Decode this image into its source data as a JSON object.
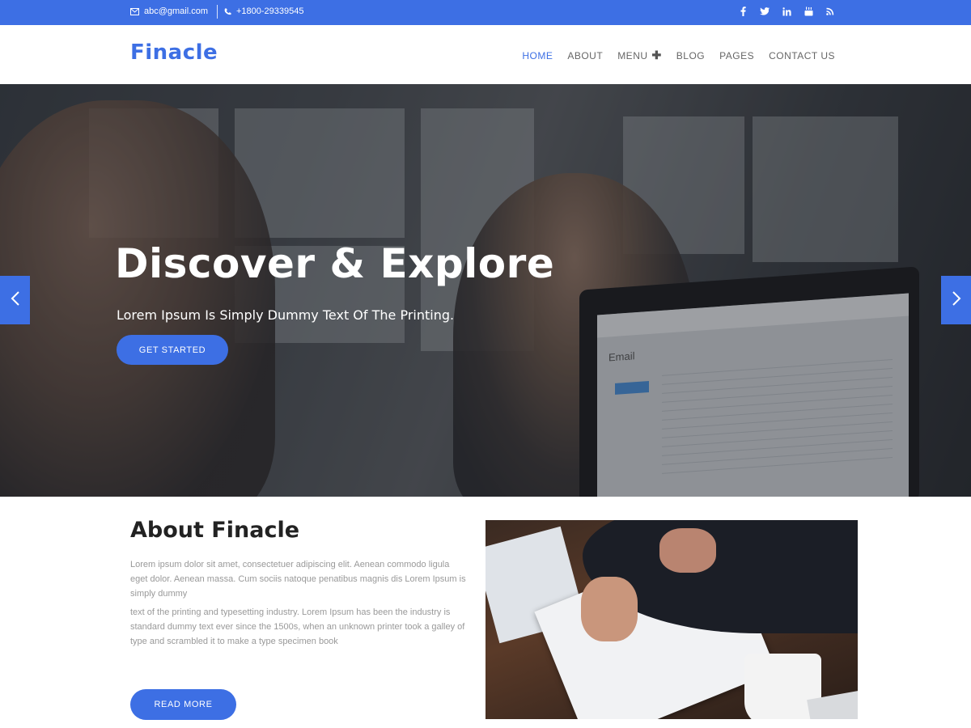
{
  "topbar": {
    "email": "abc@gmail.com",
    "phone": "+1800-29339545",
    "email_icon": "envelope-icon",
    "phone_icon": "phone-icon",
    "social": [
      "facebook-icon",
      "twitter-icon",
      "linkedin-icon",
      "youtube-icon",
      "rss-icon"
    ],
    "background": "#3d6fe4"
  },
  "header": {
    "logo": "Finacle",
    "nav": [
      {
        "label": "HOME",
        "active": true
      },
      {
        "label": "ABOUT",
        "active": false
      },
      {
        "label": "MENU",
        "active": false,
        "has_plus": true
      },
      {
        "label": "BLOG",
        "active": false
      },
      {
        "label": "PAGES",
        "active": false
      },
      {
        "label": "CONTACT US",
        "active": false
      }
    ],
    "accent": "#3d6fe4"
  },
  "hero": {
    "title": "Discover & Explore",
    "subtitle": "Lorem Ipsum Is Simply Dummy Text Of The Printing.",
    "button": "GET STARTED",
    "screen_label": "Email",
    "prev_icon": "chevron-left-icon",
    "next_icon": "chevron-right-icon"
  },
  "about": {
    "title": "About Finacle",
    "para1": "Lorem ipsum dolor sit amet, consectetuer adipiscing elit. Aenean commodo ligula eget dolor. Aenean massa. Cum sociis natoque penatibus magnis dis Lorem Ipsum is simply dummy",
    "para2": "text of the printing and typesetting industry. Lorem Ipsum has been the industry is standard dummy text ever since the 1500s, when an unknown printer took a galley of type and scrambled it to make a type specimen book",
    "button": "READ MORE"
  }
}
